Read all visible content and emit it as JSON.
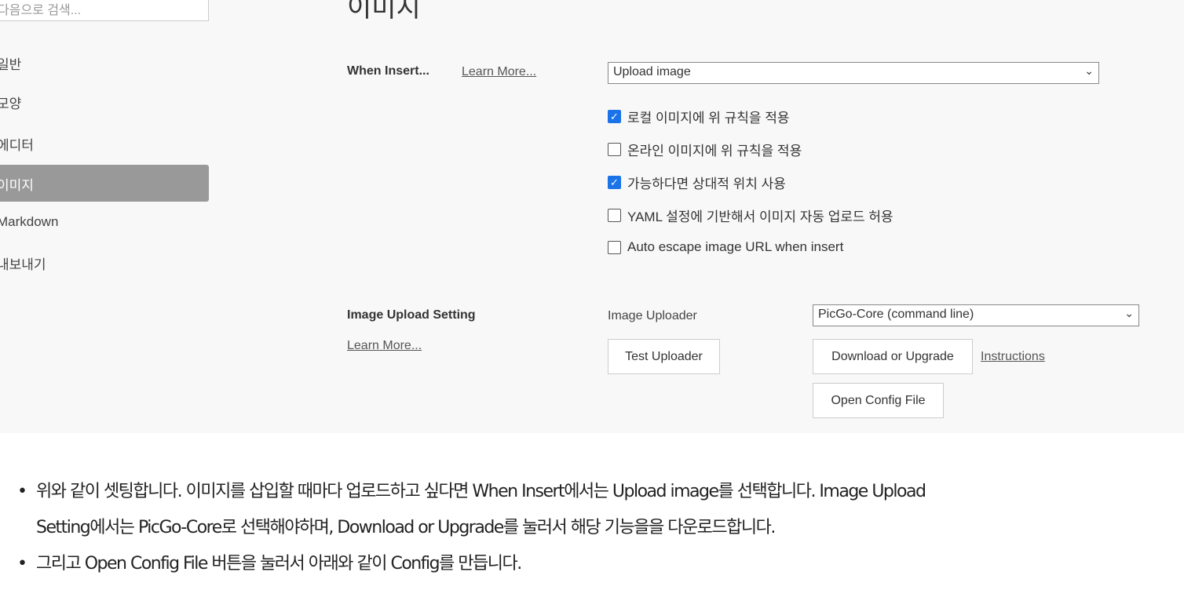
{
  "sidebar": {
    "search_placeholder": "다음으로 검색...",
    "items": [
      {
        "label": "일반"
      },
      {
        "label": "모양"
      },
      {
        "label": "에디터"
      },
      {
        "label": "이미지",
        "active": true
      },
      {
        "label": "Markdown"
      },
      {
        "label": "내보내기"
      }
    ]
  },
  "main": {
    "title": "이미지",
    "when_insert": {
      "label": "When Insert...",
      "learn_more": "Learn More...",
      "select_value": "Upload image",
      "options": [
        {
          "label": "로컬 이미지에 위 규칙을 적용",
          "checked": true
        },
        {
          "label": "온라인 이미지에 위 규칙을 적용",
          "checked": false
        },
        {
          "label": "가능하다면 상대적 위치 사용",
          "checked": true
        },
        {
          "label": "YAML 설정에 기반해서 이미지 자동 업로드 허용",
          "checked": false
        },
        {
          "label": "Auto escape image URL when insert",
          "checked": false
        }
      ]
    },
    "upload": {
      "label": "Image Upload Setting",
      "learn_more": "Learn More...",
      "uploader_label": "Image Uploader",
      "uploader_value": "PicGo-Core (command line)",
      "test_button": "Test Uploader",
      "download_button": "Download or Upgrade",
      "instructions_link": "Instructions",
      "config_button": "Open Config File"
    }
  },
  "accent": "#1a73e8",
  "article": {
    "bullets": [
      "위와 같이 셋팅합니다. 이미지를 삽입할 때마다 업로드하고 싶다면 When Insert에서는 Upload image를 선택합니다. Image Upload",
      "Setting에서는 PicGo-Core로 선택해야하며, Download or Upgrade를 눌러서 해당 기능을을 다운로드합니다.",
      "그리고 Open Config File 버튼을 눌러서 아래와 같이 Config를 만듭니다."
    ]
  }
}
